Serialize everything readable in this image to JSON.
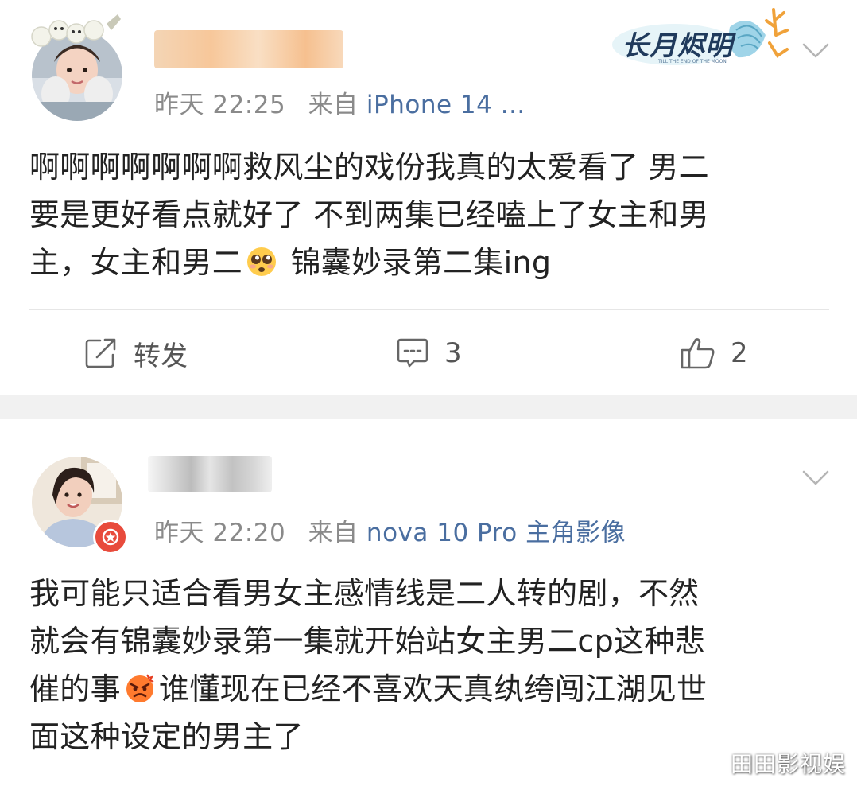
{
  "posts": [
    {
      "meta": {
        "time": "昨天 22:25",
        "source_prefix": "来自",
        "device": "iPhone 14 ..."
      },
      "badge_text": "长月烬明",
      "badge_subtext": "TILL THE END OF THE MOON",
      "content": {
        "line1": "啊啊啊啊啊啊啊救风尘的戏份我真的太爱看了 男二",
        "line2": "要是更好看点就好了 不到两集已经嗑上了女主和男",
        "line3_a": "主，女主和男二",
        "emoji": "pleading-face-emoji",
        "line3_b": " 锦囊妙录第二集ing"
      },
      "actions": {
        "repost": "转发",
        "comments": "3",
        "likes": "2"
      }
    },
    {
      "meta": {
        "time": "昨天 22:20",
        "source_prefix": "来自",
        "device": "nova 10 Pro 主角影像"
      },
      "content": {
        "line1": "我可能只适合看男女主感情线是二人转的剧，不然",
        "line2": "就会有锦囊妙录第一集就开始站女主男二cp这种悲",
        "line3_a": "催的事",
        "emoji": "angry-face-emoji",
        "line3_b": "谁懂现在已经不喜欢天真纨绔闯江湖见世",
        "line4": "面这种设定的男主了"
      }
    }
  ],
  "watermark": "田田影视娱",
  "colors": {
    "meta_gray": "#8a8a8a",
    "device_blue": "#4a6ea0",
    "text": "#222222",
    "vip_red": "#e84b3c",
    "separator": "#f1f1f1"
  },
  "icons": [
    "chevron-down-icon",
    "repost-icon",
    "comment-icon",
    "like-icon",
    "vip-badge-icon"
  ]
}
